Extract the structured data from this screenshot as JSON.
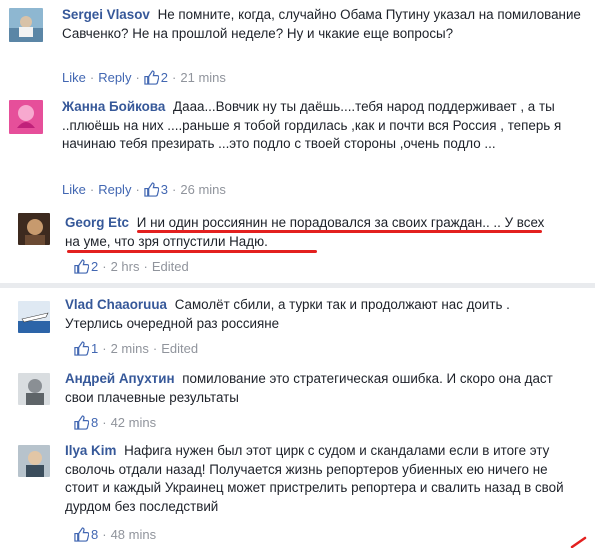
{
  "comments_top": [
    {
      "name": "Sergei Vlasov",
      "text": "Не помните, когда, случайно Обама Путину указал на помилование Савченко? Не на прошлой неделе? Ну и чкакие еще вопросы?",
      "like": "Like",
      "reply": "Reply",
      "likes": "2",
      "time": "21 mins",
      "avatar_icon": "profile-photo-icon"
    },
    {
      "name": "Жанна Бойкова",
      "text": "Дааа...Вовчик ну ты даёшь....тебя народ поддерживает , а ты ..плюёшь на них ....раньше я тобой гордилась ,как и почти вся Россия , теперь я начинаю тебя презирать ...это подло с твоей стороны ,очень подло ...",
      "like": "Like",
      "reply": "Reply",
      "likes": "3",
      "time": "26 mins",
      "avatar_icon": "profile-photo-icon"
    },
    {
      "name": "Georg Etc",
      "text": "И ни один россиянин не порадовался за своих граждан.. .. У всех на уме, что зря отпустили Надю.",
      "likes": "2",
      "time": "2 hrs",
      "edited": "Edited",
      "avatar_icon": "profile-photo-icon"
    }
  ],
  "comments_bottom": [
    {
      "name": "Vlad Chaaoruua",
      "text": "Самолёт сбили, а турки так и продолжают нас доить . Утерлись очередной раз россияне",
      "likes": "1",
      "time": "2 mins",
      "edited": "Edited",
      "avatar_icon": "airplane-photo-icon"
    },
    {
      "name": "Андрей Апухтин",
      "text": "помилование это стратегическая ошибка. И скоро она даст свои плачевные результаты",
      "likes": "8",
      "time": "42 mins",
      "avatar_icon": "profile-photo-icon"
    },
    {
      "name": "Ilya Kim",
      "text": "Нафига нужен был этот цирк с судом и скандалами если в итоге эту сволочь отдали назад! Получается жизнь репортеров убиенных ею ничего не стоит и каждый Украинец может пристрелить репортера и свалить назад в свой дурдом без последствий",
      "likes": "8",
      "time": "48 mins",
      "avatar_icon": "profile-photo-icon"
    }
  ],
  "colors": {
    "name": "#365899",
    "link": "#4267b2",
    "meta": "#90949c",
    "underline": "#e3201f",
    "separator": "#e9ebee"
  }
}
